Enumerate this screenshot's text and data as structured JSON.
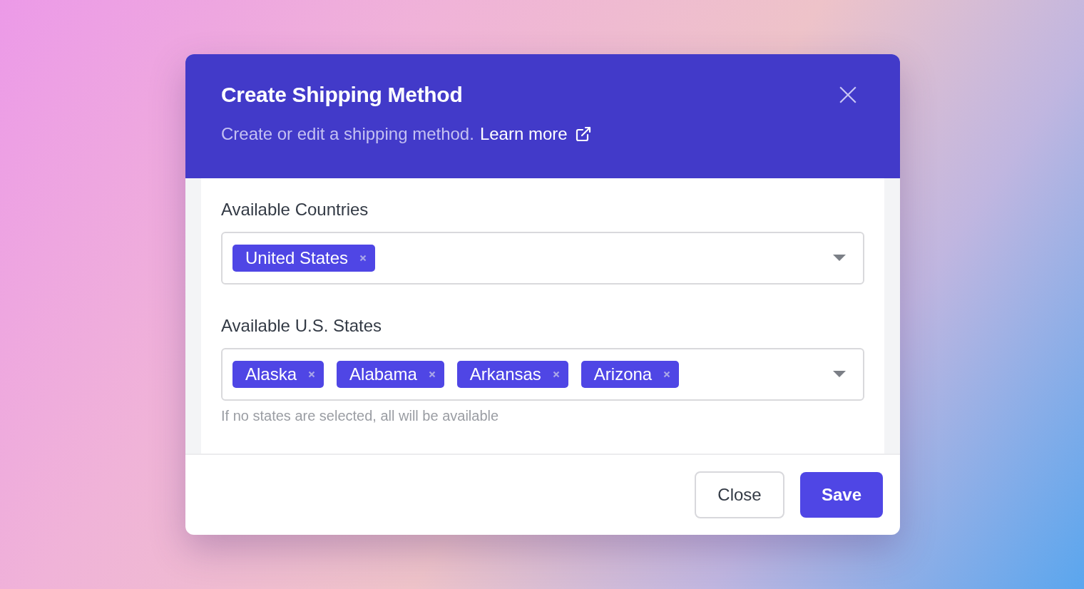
{
  "dialog": {
    "title": "Create Shipping Method",
    "subtitle": "Create or edit a shipping method.",
    "link": "Learn more",
    "fields": [
      {
        "label": "Available Countries",
        "chips": [
          "United States"
        ]
      },
      {
        "label": "Available U.S. States",
        "chips": [
          "Alaska",
          "Alabama",
          "Arkansas",
          "Arizona"
        ],
        "hint": "If no states are selected, all will be available"
      }
    ],
    "buttons": [
      {
        "label": "Close",
        "kind": "secondary"
      },
      {
        "label": "Save",
        "kind": "primary"
      }
    ]
  }
}
